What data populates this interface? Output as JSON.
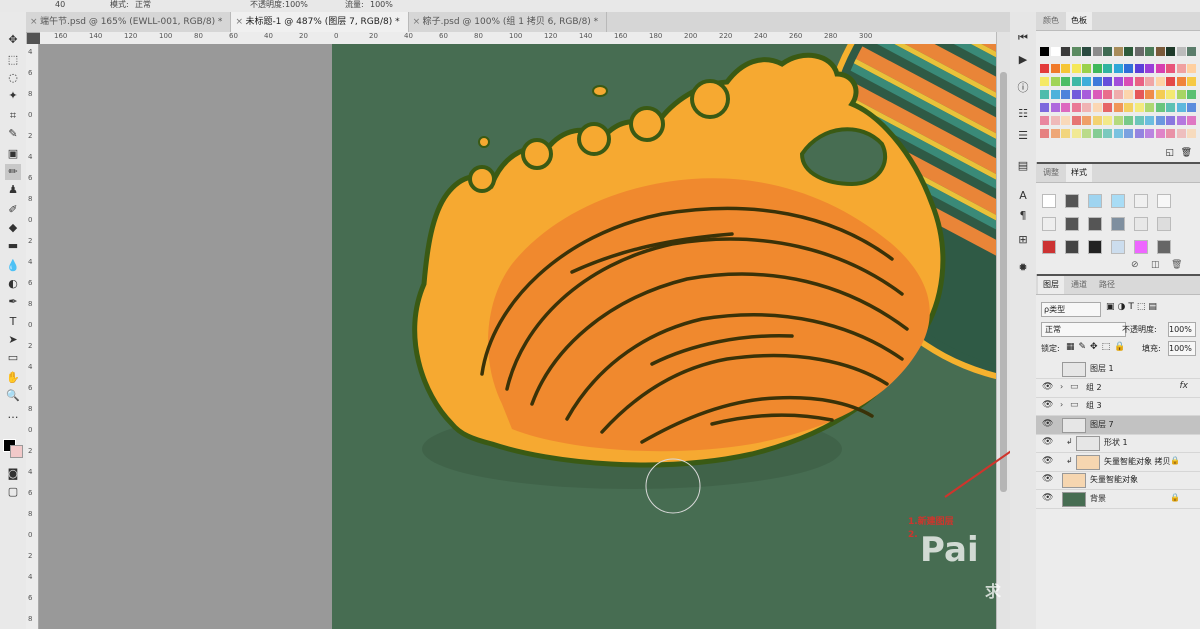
{
  "options_bar": {
    "size": "40",
    "mode_label": "模式:",
    "mode_value": "正常",
    "opacity_label": "不透明度:",
    "opacity_value": "100%",
    "flow_label": "流量:",
    "flow_value": "100%"
  },
  "tabs": [
    {
      "label": "端午节.psd @ 165% (EWLL-001, RGB/8) *"
    },
    {
      "label": "未标题-1 @ 487% (图层 7, RGB/8) *"
    },
    {
      "label": "粽子.psd @ 100% (组 1 拷贝 6, RGB/8) *"
    }
  ],
  "ruler_top": [
    "160",
    "140",
    "120",
    "100",
    "80",
    "60",
    "40",
    "20",
    "0",
    "20",
    "40",
    "60",
    "80",
    "100",
    "120",
    "140",
    "160",
    "180",
    "200",
    "220",
    "240",
    "260",
    "280",
    "300"
  ],
  "ruler_left": [
    "4",
    "6",
    "8",
    "0",
    "2",
    "4",
    "6",
    "8",
    "0",
    "2",
    "4",
    "6",
    "8",
    "0",
    "2",
    "4",
    "6",
    "8",
    "0",
    "2",
    "4",
    "6",
    "8",
    "0",
    "2",
    "4",
    "6",
    "8"
  ],
  "color_panel": {
    "tabs": [
      "颜色",
      "色板"
    ],
    "active": "色板"
  },
  "styles_panel": {
    "tabs": [
      "调整",
      "样式"
    ],
    "active": "样式"
  },
  "layers_panel": {
    "tabs": [
      "图层",
      "通道",
      "路径"
    ],
    "active": "图层",
    "filter_label": "ρ类型",
    "blend_mode": "正常",
    "opacity_label": "不透明度:",
    "opacity_value": "100%",
    "lock_label": "锁定:",
    "fill_label": "填充:",
    "fill_value": "100%",
    "layers": [
      {
        "name": "图层 1",
        "visible": false,
        "type": "layer",
        "selected": false
      },
      {
        "name": "组 2",
        "visible": true,
        "type": "group",
        "fx": "fx",
        "selected": false
      },
      {
        "name": "组 3",
        "visible": true,
        "type": "group",
        "selected": false
      },
      {
        "name": "图层 7",
        "visible": true,
        "type": "layer",
        "selected": true
      },
      {
        "name": "形状 1",
        "visible": true,
        "type": "shape",
        "selected": false
      },
      {
        "name": "矢量智能对象 拷贝",
        "visible": true,
        "type": "smart",
        "selected": false
      },
      {
        "name": "矢量智能对象",
        "visible": true,
        "type": "smart",
        "selected": false
      },
      {
        "name": "背景",
        "visible": true,
        "type": "background",
        "selected": false
      }
    ]
  },
  "annotation": {
    "line1": "1.新建图层",
    "line2": "2."
  },
  "watermark": {
    "text": "Pai",
    "sub": "求"
  },
  "colors": {
    "canvas": "#476d52",
    "wave_fill": "#f0892e",
    "wave_light": "#f6a931",
    "outline": "#3a5a14",
    "annotation": "#d0342c"
  }
}
